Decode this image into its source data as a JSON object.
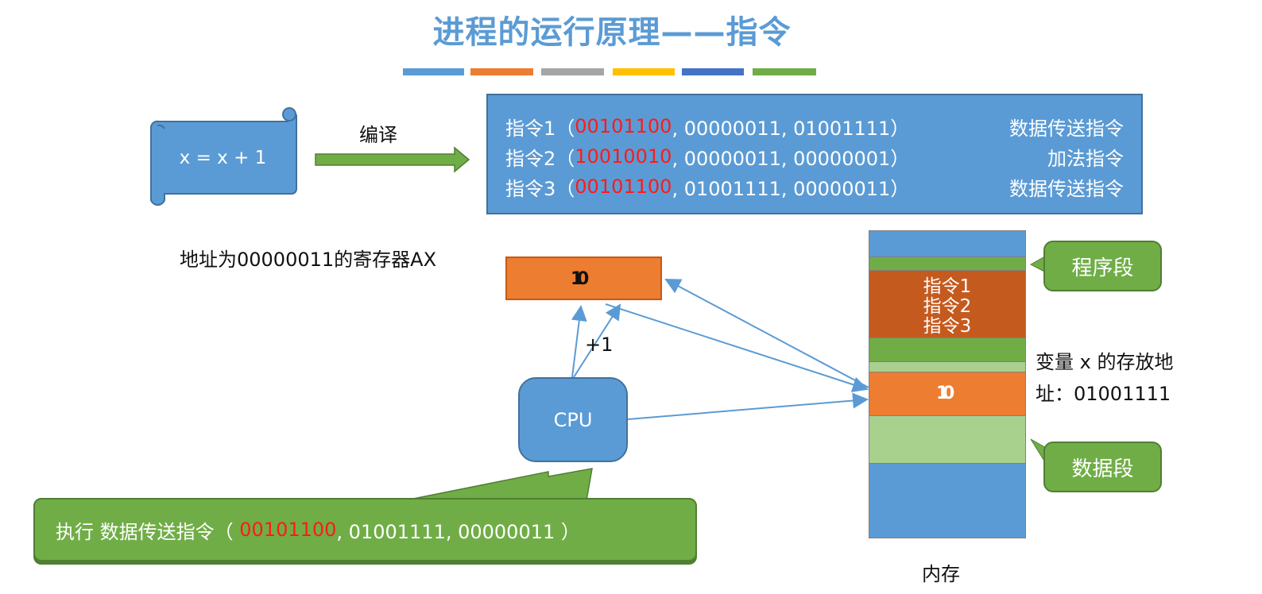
{
  "title": "进程的运行原理——指令",
  "title_bar_colors": [
    "#5b9bd5",
    "#ed7d31",
    "#a5a5a5",
    "#ffc000",
    "#4472c4",
    "#70ad47"
  ],
  "source_code": "x = x + 1",
  "compile_label": "编译",
  "instructions": [
    {
      "name": "指令1",
      "open": "（",
      "opcode": "00101100",
      "operands": ", 00000011, 01001111）",
      "type": "数据传送指令"
    },
    {
      "name": "指令2",
      "open": "（",
      "opcode": "10010010",
      "operands": ", 00000011, 00000001）",
      "type": "加法指令"
    },
    {
      "name": "指令3",
      "open": "（",
      "opcode": "00101100",
      "operands": ", 01001111, 00000011）",
      "type": "数据传送指令"
    }
  ],
  "register": {
    "label": "地址为00000011的寄存器AX",
    "value_old": "1",
    "value_new": "0"
  },
  "plus_one": "+1",
  "cpu_label": "CPU",
  "memory": {
    "label": "内存",
    "instr_labels": [
      "指令1",
      "指令2",
      "指令3"
    ],
    "var_value_old": "1",
    "var_value_new": "0",
    "program_segment": "程序段",
    "data_segment": "数据段",
    "var_address_label_line1": "变量 x 的存放地",
    "var_address_label_line2": "址：01001111"
  },
  "exec_callout": {
    "prefix": "执行 数据传送指令（ ",
    "opcode": "00101100",
    "rest": ", 01001111, 00000011 ）"
  }
}
